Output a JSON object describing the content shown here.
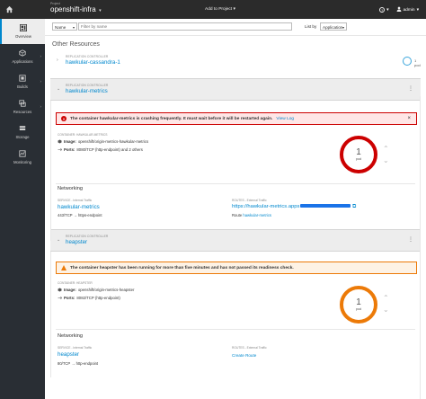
{
  "topbar": {
    "project_label": "Project",
    "project_name": "openshift-infra",
    "add_to_project": "Add to Project",
    "help_icon": "help-icon",
    "user": "admin"
  },
  "sidebar": {
    "items": [
      {
        "label": "Overview",
        "icon": "dashboard-icon",
        "active": true
      },
      {
        "label": "Applications",
        "icon": "cubes-icon",
        "caret": true
      },
      {
        "label": "Builds",
        "icon": "build-icon",
        "caret": true
      },
      {
        "label": "Resources",
        "icon": "resources-icon",
        "caret": true
      },
      {
        "label": "Storage",
        "icon": "storage-icon"
      },
      {
        "label": "Monitoring",
        "icon": "monitoring-icon"
      }
    ]
  },
  "toolbar": {
    "filter_by": "Name",
    "filter_placeholder": "Filter by name",
    "list_by_label": "List by",
    "list_by_value": "Application"
  },
  "section_title": "Other Resources",
  "cassandra": {
    "kind": "REPLICATION CONTROLLER",
    "name": "hawkular-cassandra-1",
    "pods": "1 pod"
  },
  "metrics": {
    "kind": "REPLICATION CONTROLLER",
    "name": "hawkular-metrics",
    "alert_message": "The container hawkular-metrics is crashing frequently. It must wait before it will be restarted again.",
    "alert_link": "View Log",
    "container_label": "CONTAINER: HAWKULAR-METRICS",
    "image_label": "Image:",
    "image_value": "openshift/origin-metrics-hawkular-metrics",
    "ports_label": "Ports:",
    "ports_value": "8080/TCP (http-endpoint) and 2 others",
    "pod_count": "1",
    "pod_label": "pod",
    "pod_color": "#cc0000",
    "networking_title": "Networking",
    "service_label": "SERVICE - Internal Traffic",
    "service_name": "hawkular-metrics",
    "service_ports": "443/TCP → https-endpoint",
    "routes_label": "ROUTES - External Traffic",
    "route_url": "https://hawkular-metrics.apps",
    "route_suffix": "",
    "route_prefix": "Route",
    "route_name": "hawkular-metrics"
  },
  "heapster": {
    "kind": "REPLICATION CONTROLLER",
    "name": "heapster",
    "alert_message": "The container heapster has been running for more than five minutes and has not passed its readiness check.",
    "container_label": "CONTAINER: HEAPSTER",
    "image_label": "Image:",
    "image_value": "openshift/origin-metrics-heapster",
    "ports_label": "Ports:",
    "ports_value": "8082/TCP (http-endpoint)",
    "pod_count": "1",
    "pod_label": "pod",
    "pod_color": "#ec7a08",
    "networking_title": "Networking",
    "service_label": "SERVICE - Internal Traffic",
    "service_name": "heapster",
    "service_ports": "80/TCP → http-endpoint",
    "routes_label": "ROUTES - External Traffic",
    "create_route": "Create Route"
  }
}
